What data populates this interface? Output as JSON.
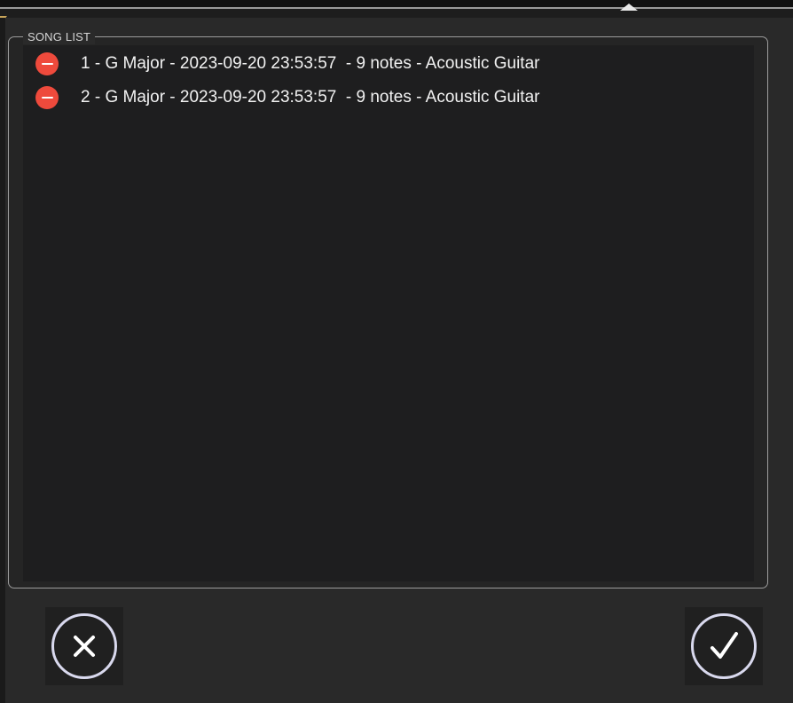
{
  "song_list": {
    "legend": "SONG LIST",
    "items": [
      {
        "label": "1 - G Major - 2023-09-20 23:53:57  - 9 notes - Acoustic Guitar"
      },
      {
        "label": "2 - G Major - 2023-09-20 23:53:57  - 9 notes - Acoustic Guitar"
      }
    ]
  },
  "icons": {
    "delete": "minus-circle-icon",
    "cancel": "x-circle-icon",
    "confirm": "checkmark-circle-icon"
  },
  "colors": {
    "delete_red": "#ee4a3c",
    "icon_stroke": "#d9d9ee",
    "panel_bg": "#1e1e1f"
  }
}
